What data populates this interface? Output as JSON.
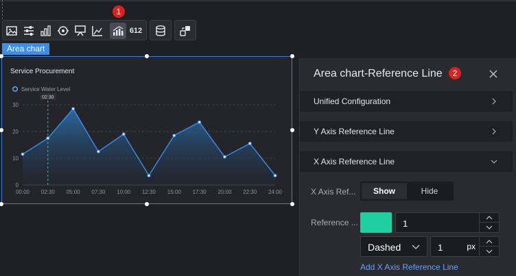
{
  "toolbar": {
    "groups": [
      [
        "image-icon",
        "sliders-icon",
        "bar-chart-icon",
        "radar-icon",
        "board-icon",
        "scatter-icon",
        "area-chart-icon",
        "number-icon"
      ],
      [
        "database-icon"
      ],
      [
        "share-icon"
      ]
    ],
    "number_text": "612",
    "active": "area-chart-icon"
  },
  "badges": {
    "first": "1",
    "second": "2"
  },
  "widget": {
    "tag": "Area chart"
  },
  "chart_data": {
    "type": "area",
    "title": "Service Procurement",
    "legend": [
      "Service Water Level"
    ],
    "legend_position": "top-left",
    "x": [
      "00:00",
      "02:30",
      "05:00",
      "07:30",
      "10:00",
      "12:30",
      "15:00",
      "17:30",
      "20:00",
      "22:30",
      "24:00"
    ],
    "series": [
      {
        "name": "Service Water Level",
        "values": [
          11.5,
          17.5,
          28.5,
          12.5,
          19,
          3.5,
          18.5,
          23.5,
          10.5,
          15.5,
          3.5
        ]
      }
    ],
    "ylim": [
      0,
      30
    ],
    "yticks": [
      "0",
      "10",
      "20",
      "30"
    ],
    "grid": true,
    "reference_line": {
      "x": "02:30",
      "label": "02:30"
    },
    "colors": {
      "line": "#3b8ff0",
      "area_top": "#2a6da8",
      "reference": "#1fcfa0"
    }
  },
  "panel": {
    "title": "Area chart-Reference Line",
    "sections": {
      "unified": "Unified Configuration",
      "y_axis": "Y Axis Reference Line",
      "x_axis": "X Axis Reference Line"
    },
    "x_axis_ref_label": "X Axis Ref...",
    "show_label": "Show",
    "hide_label": "Hide",
    "reference_label": "Reference ...",
    "reference_color": "#1fcfa0",
    "reference_value": "1",
    "line_style": "Dashed",
    "line_width": "1",
    "line_width_unit": "px",
    "add_link": "Add X Axis Reference Line"
  }
}
